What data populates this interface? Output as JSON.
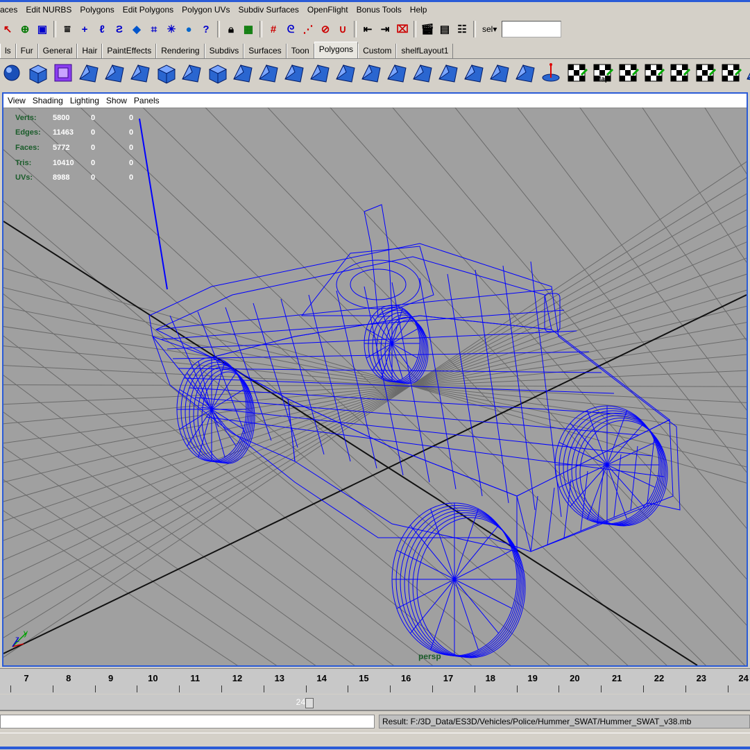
{
  "menubar": [
    "aces",
    "Edit NURBS",
    "Polygons",
    "Edit Polygons",
    "Polygon UVs",
    "Subdiv Surfaces",
    "OpenFlight",
    "Bonus Tools",
    "Help"
  ],
  "statusline": {
    "selection_mode": "sel",
    "selection_field": ""
  },
  "shelf_tabs": [
    "ls",
    "Fur",
    "General",
    "Hair",
    "PaintEffects",
    "Rendering",
    "Subdivs",
    "Surfaces",
    "Toon",
    "Polygons",
    "Custom",
    "shelfLayout1"
  ],
  "shelf_active_tab": "Polygons",
  "shelf_labels": {
    "map": "Map",
    "flip": "Flip",
    "soft": "Soft",
    "hard": "Hard",
    "tri": "Tri",
    "flip_e": "Flip E",
    "del_e": "Del E"
  },
  "viewport": {
    "menu": [
      "View",
      "Shading",
      "Lighting",
      "Show",
      "Panels"
    ],
    "camera": "persp",
    "axis_y": "y",
    "axis_z": "z",
    "hud": [
      {
        "label": "Verts:",
        "value": "5800",
        "c1": "0",
        "c2": "0"
      },
      {
        "label": "Edges:",
        "value": "11463",
        "c1": "0",
        "c2": "0"
      },
      {
        "label": "Faces:",
        "value": "5772",
        "c1": "0",
        "c2": "0"
      },
      {
        "label": "Tris:",
        "value": "10410",
        "c1": "0",
        "c2": "0"
      },
      {
        "label": "UVs:",
        "value": "8988",
        "c1": "0",
        "c2": "0"
      }
    ]
  },
  "timeline": {
    "frames": [
      "7",
      "8",
      "9",
      "10",
      "11",
      "12",
      "13",
      "14",
      "15",
      "16",
      "17",
      "18",
      "19",
      "20",
      "21",
      "22",
      "23",
      "24"
    ],
    "end_frame": "24"
  },
  "command_line": {
    "input": "",
    "result": "Result: F:/3D_Data/ES3D/Vehicles/Police/Hummer_SWAT/Hummer_SWAT_v38.mb"
  },
  "colors": {
    "wire": "#0000ff",
    "viewport_bg": "#a0a0a0",
    "hud_label": "#1a5c2a",
    "highlight": "#2a5bd7"
  }
}
